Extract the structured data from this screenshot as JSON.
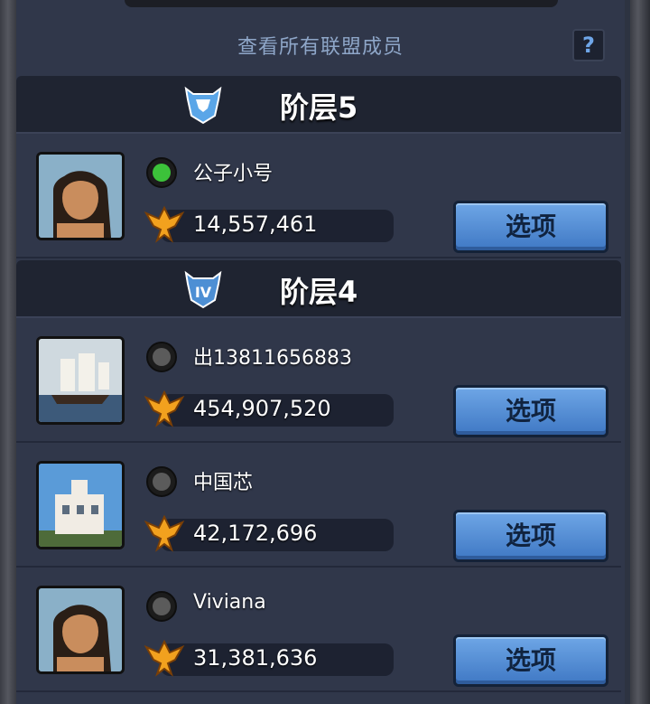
{
  "header": {
    "title": "查看所有联盟成员",
    "help_label": "?"
  },
  "tiers": [
    {
      "title": "阶层5",
      "badge_icon": "tier-5-shield-icon",
      "members": [
        {
          "name": "公子小号",
          "online": true,
          "power": "14,557,461",
          "avatar": "warrior-avatar",
          "options_label": "选项"
        }
      ]
    },
    {
      "title": "阶层4",
      "badge_icon": "tier-4-shield-icon",
      "members": [
        {
          "name": "出13811656883",
          "online": false,
          "power": "454,907,520",
          "avatar": "sailing-ship-avatar",
          "options_label": "选项"
        },
        {
          "name": "中国芯",
          "online": false,
          "power": "42,172,696",
          "avatar": "building-avatar",
          "options_label": "选项"
        },
        {
          "name": "Viviana",
          "online": false,
          "power": "31,381,636",
          "avatar": "warrior-avatar",
          "options_label": "选项"
        }
      ]
    }
  ],
  "colors": {
    "online": "#3cc23a",
    "offline": "#5b5b5b",
    "button": "#4f8cd8"
  }
}
